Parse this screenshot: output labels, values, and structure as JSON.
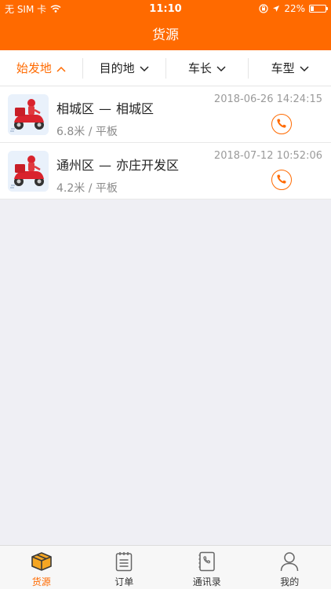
{
  "status_bar": {
    "carrier": "无 SIM 卡",
    "time": "11:10",
    "battery": "22%",
    "battery_level": 0.22
  },
  "navbar": {
    "title": "货源"
  },
  "filters": [
    {
      "label": "始发地",
      "active": true
    },
    {
      "label": "目的地",
      "active": false
    },
    {
      "label": "车长",
      "active": false
    },
    {
      "label": "车型",
      "active": false
    }
  ],
  "listings": [
    {
      "from": "相城区",
      "dash": "—",
      "to": "相城区",
      "length_type": "6.8米 / 平板",
      "time": "2018-06-26 14:24:15"
    },
    {
      "from": "通州区",
      "dash": "—",
      "to": "亦庄开发区",
      "length_type": "4.2米 / 平板",
      "time": "2018-07-12 10:52:06"
    }
  ],
  "tabbar": {
    "tabs": [
      {
        "label": "货源",
        "icon": "box-icon",
        "active": true
      },
      {
        "label": "订单",
        "icon": "notepad-icon",
        "active": false
      },
      {
        "label": "通讯录",
        "icon": "phonebook-icon",
        "active": false
      },
      {
        "label": "我的",
        "icon": "person-icon",
        "active": false
      }
    ]
  },
  "colors": {
    "accent": "#ff6a00",
    "background": "#efeff4"
  }
}
